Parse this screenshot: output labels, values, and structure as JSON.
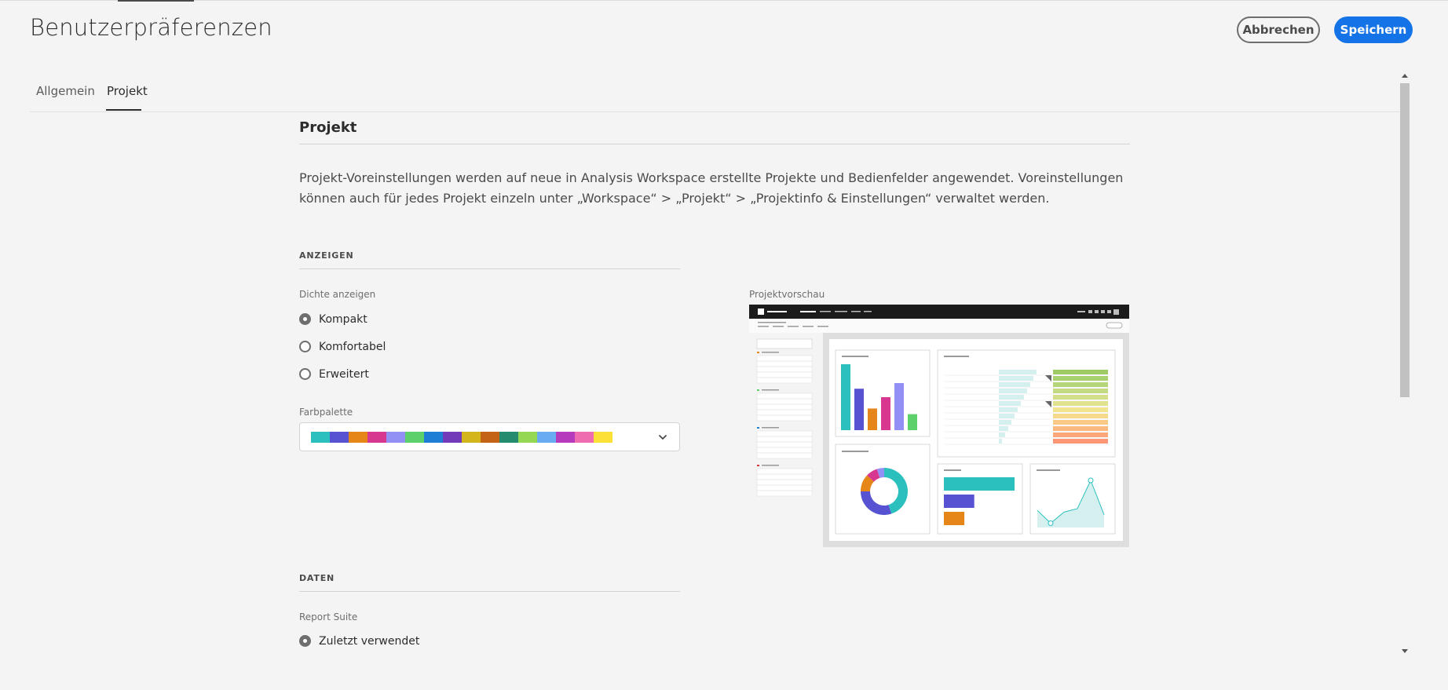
{
  "page": {
    "title": "Benutzerpräferenzen",
    "cancel_label": "Abbrechen",
    "save_label": "Speichern"
  },
  "tabs": [
    {
      "label": "Allgemein",
      "active": false
    },
    {
      "label": "Projekt",
      "active": true
    }
  ],
  "section": {
    "title": "Projekt",
    "description": "Projekt-Voreinstellungen werden auf neue in Analysis Workspace erstellte Projekte und Bedienfelder angewendet. Voreinstellungen können auch für jedes Projekt einzeln unter „Workspace“ > „Projekt“ > „Projektinfo & Einstellungen“ verwaltet werden."
  },
  "display": {
    "heading": "ANZEIGEN",
    "density_label": "Dichte anzeigen",
    "density_options": [
      {
        "label": "Kompakt",
        "checked": true
      },
      {
        "label": "Komfortabel",
        "checked": false
      },
      {
        "label": "Erweitert",
        "checked": false
      }
    ],
    "palette_label": "Farbpalette",
    "palette_colors": [
      "#2bc0be",
      "#5652d1",
      "#e68619",
      "#d83790",
      "#9390f5",
      "#5bd06b",
      "#1e7ed6",
      "#7239b8",
      "#d4b61c",
      "#c46315",
      "#248b6f",
      "#93d752",
      "#69abf3",
      "#b63abc",
      "#f06cb1",
      "#fde037"
    ]
  },
  "preview": {
    "label": "Projektvorschau",
    "bar_chart": [
      70,
      44,
      23,
      35,
      50,
      17
    ],
    "bar_colors": [
      "#2bc0be",
      "#5652d1",
      "#e68619",
      "#d83790",
      "#9390f5",
      "#5bd06b"
    ],
    "donut": [
      {
        "value": 45,
        "color": "#2bc0be"
      },
      {
        "value": 30,
        "color": "#5652d1"
      },
      {
        "value": 12,
        "color": "#e68619"
      },
      {
        "value": 8,
        "color": "#d83790"
      },
      {
        "value": 5,
        "color": "#9390f5"
      }
    ],
    "hbar_chart": [
      100,
      43,
      29
    ],
    "hbar_colors": [
      "#2bc0be",
      "#5652d1",
      "#e68619"
    ],
    "line_chart": [
      20,
      5,
      18,
      22,
      55,
      15
    ],
    "heat_colors": [
      "#9ecb64",
      "#a7d06e",
      "#b4d579",
      "#c3da82",
      "#d2de88",
      "#e2e18d",
      "#f2e38f",
      "#f7d98b",
      "#f9c985",
      "#fab97e",
      "#fba779",
      "#fc9674"
    ]
  },
  "data_section": {
    "heading": "DATEN",
    "report_suite_label": "Report Suite",
    "report_suite_option": "Zuletzt verwendet",
    "report_suite_checked": true
  }
}
